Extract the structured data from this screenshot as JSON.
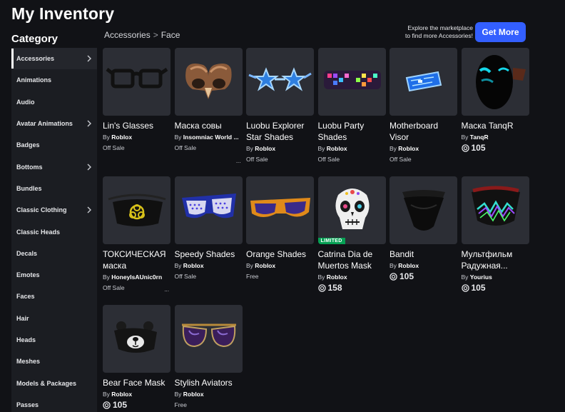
{
  "page": {
    "title": "My Inventory",
    "category_heading": "Category"
  },
  "sidebar": {
    "items": [
      {
        "label": "Accessories",
        "has_chevron": true,
        "active": true
      },
      {
        "label": "Animations",
        "has_chevron": false
      },
      {
        "label": "Audio",
        "has_chevron": false
      },
      {
        "label": "Avatar Animations",
        "has_chevron": true
      },
      {
        "label": "Badges",
        "has_chevron": false
      },
      {
        "label": "Bottoms",
        "has_chevron": true
      },
      {
        "label": "Bundles",
        "has_chevron": false
      },
      {
        "label": "Classic Clothing",
        "has_chevron": true
      },
      {
        "label": "Classic Heads",
        "has_chevron": false
      },
      {
        "label": "Decals",
        "has_chevron": false
      },
      {
        "label": "Emotes",
        "has_chevron": false
      },
      {
        "label": "Faces",
        "has_chevron": false
      },
      {
        "label": "Hair",
        "has_chevron": false
      },
      {
        "label": "Heads",
        "has_chevron": false
      },
      {
        "label": "Meshes",
        "has_chevron": false
      },
      {
        "label": "Models & Packages",
        "has_chevron": false
      },
      {
        "label": "Passes",
        "has_chevron": false
      }
    ]
  },
  "breadcrumb": {
    "parent": "Accessories",
    "separator": ">",
    "current": "Face"
  },
  "promo": {
    "line1": "Explore the marketplace",
    "line2": "to find more Accessories!",
    "button": "Get More"
  },
  "colors": {
    "accent": "#335fff",
    "limited": "#06a054",
    "card_bg": "#2c2e35",
    "sidebar_bg": "#1b1d22"
  },
  "items": [
    {
      "name": "Lin's Glasses",
      "by": "By",
      "creator": "Roblox",
      "status": "Off Sale",
      "icon": "black-glasses"
    },
    {
      "name": "Маска совы",
      "by": "By",
      "creator": "Insomniac World ...",
      "status": "Off Sale",
      "icon": "owl-mask",
      "ellipsis": "..."
    },
    {
      "name": "Luobu Explorer Star Shades",
      "by": "By",
      "creator": "Roblox",
      "status": "Off Sale",
      "icon": "star-shades"
    },
    {
      "name": "Luobu Party Shades",
      "by": "By",
      "creator": "Roblox",
      "status": "Off Sale",
      "icon": "party-shades"
    },
    {
      "name": "Motherboard Visor",
      "by": "By",
      "creator": "Roblox",
      "status": "Off Sale",
      "icon": "motherboard-visor"
    },
    {
      "name": "Маска TanqR",
      "by": "By",
      "creator": "TanqR",
      "price": "105",
      "icon": "tanqr-mask"
    },
    {
      "name": "ТОКСИЧЕСКАЯ маска",
      "by": "By",
      "creator": "HoneyIsAUnic0rn",
      "status": "Off Sale",
      "icon": "toxic-mask",
      "ellipsis": "..."
    },
    {
      "name": "Speedy Shades",
      "by": "By",
      "creator": "Roblox",
      "status": "Off Sale",
      "icon": "speedy-shades"
    },
    {
      "name": "Orange Shades",
      "by": "By",
      "creator": "Roblox",
      "status": "Free",
      "icon": "orange-shades"
    },
    {
      "name": "Catrina Dia de Muertos Mask",
      "by": "By",
      "creator": "Roblox",
      "price": "158",
      "limited": "LIMITED",
      "icon": "skull-mask"
    },
    {
      "name": "Bandit",
      "by": "By",
      "creator": "Roblox",
      "price": "105",
      "icon": "bandit-mask"
    },
    {
      "name": "Мультфильм Радужная...",
      "by": "By",
      "creator": "Yourius",
      "price": "105",
      "icon": "rainbow-mask"
    },
    {
      "name": "Bear Face Mask",
      "by": "By",
      "creator": "Roblox",
      "price": "105",
      "icon": "bear-mask"
    },
    {
      "name": "Stylish Aviators",
      "by": "By",
      "creator": "Roblox",
      "status": "Free",
      "icon": "aviators"
    }
  ]
}
